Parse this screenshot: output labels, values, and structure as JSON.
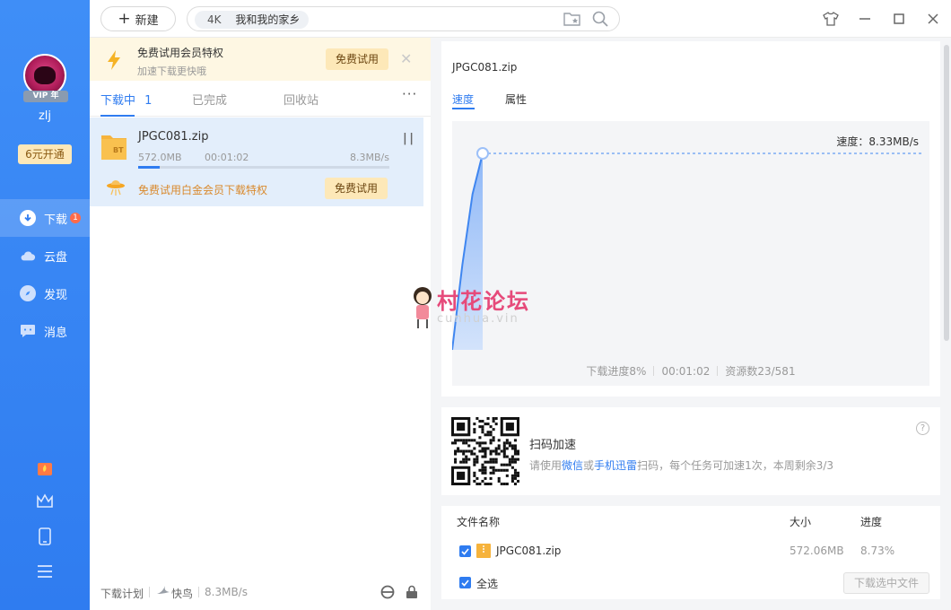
{
  "colors": {
    "accent": "#2f7cf0",
    "sidebar": "#3f8ef7",
    "promo_bg": "#fef7e3",
    "try_btn_bg": "#fde8b8",
    "selected_item_bg": "#e3eefb"
  },
  "sidebar": {
    "username": "zlj",
    "vip_badge": "VIP 年",
    "open_vip_label": "6元开通",
    "nav": [
      {
        "label": "下载",
        "icon": "download-icon",
        "badge": "1",
        "active": true
      },
      {
        "label": "云盘",
        "icon": "cloud-icon"
      },
      {
        "label": "发现",
        "icon": "compass-icon"
      },
      {
        "label": "消息",
        "icon": "message-icon"
      }
    ],
    "tools": [
      "gift-icon",
      "crown-icon",
      "phone-icon",
      "menu-icon"
    ]
  },
  "topbar": {
    "new_label": "新建",
    "search_tag_resolution": "4K",
    "search_tag_title": "我和我的家乡",
    "icons": [
      "folder-star-icon",
      "search-icon"
    ],
    "window_controls": [
      "skin-icon",
      "minimize-icon",
      "maximize-icon",
      "close-icon"
    ]
  },
  "promo": {
    "title": "免费试用会员特权",
    "subtitle": "加速下载更快哦",
    "button": "免费试用"
  },
  "tabs": {
    "downloading": "下载中",
    "downloading_count": "1",
    "completed": "已完成",
    "recycle": "回收站",
    "more": "···"
  },
  "download_item": {
    "name": "JPGC081.zip",
    "size": "572.0MB",
    "elapsed": "00:01:02",
    "speed": "8.3MB/s",
    "progress_fraction": 0.0873,
    "file_badge": "BT",
    "promo_text": "免费试用白金会员下载特权",
    "promo_button": "免费试用"
  },
  "bottombar": {
    "plan": "下载计划",
    "mode": "快鸟",
    "speed": "8.3MB/s"
  },
  "detail": {
    "title": "JPGC081.zip",
    "tab_speed": "速度",
    "tab_props": "属性",
    "speed_label": "速度：8.33MB/s",
    "stat_progress": "下载进度8%",
    "stat_time": "00:01:02",
    "stat_sources": "资源数23/581"
  },
  "chart_data": {
    "type": "area",
    "series": [
      {
        "values": [
          0,
          3.6,
          6.6,
          8.33
        ]
      }
    ]
  },
  "watermark": {
    "text": "村花论坛",
    "subtext": "cunhua.vin"
  },
  "qr": {
    "title": "扫码加速",
    "desc_prefix": "请使用",
    "link1": "微信",
    "or": "或",
    "link2": "手机迅雷",
    "desc_suffix": "扫码，每个任务可加速1次，本周剩余3/3",
    "help": "?"
  },
  "files": {
    "header_name": "文件名称",
    "header_size": "大小",
    "header_progress": "进度",
    "rows": [
      {
        "name": "JPGC081.zip",
        "size": "572.06MB",
        "progress": "8.73%"
      }
    ],
    "select_all": "全选",
    "download_selected": "下载选中文件"
  }
}
